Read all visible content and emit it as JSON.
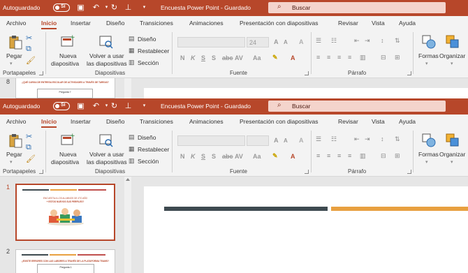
{
  "titlebar": {
    "autosave_label": "Autoguardado",
    "autosave_state": "Sí",
    "doc_title": "Encuesta Power Point  -  Guardado",
    "search_placeholder": "Buscar"
  },
  "tabs": [
    "Archivo",
    "Inicio",
    "Insertar",
    "Diseño",
    "Transiciones",
    "Animaciones",
    "Presentación con diapositivas",
    "Revisar",
    "Vista",
    "Ayuda"
  ],
  "active_tab": "Inicio",
  "ribbon": {
    "paste_label": "Pegar",
    "new_slide_line1": "Nueva",
    "new_slide_line2": "diapositiva",
    "reuse_line1": "Volver a usar",
    "reuse_line2": "las diapositivas",
    "layout_label": "Diseño",
    "reset_label": "Restablecer",
    "section_label": "Sección",
    "font_size": "24",
    "format_buttons": [
      "N",
      "K",
      "S",
      "S",
      "AV",
      "Aa"
    ],
    "shapes_label": "Formas",
    "arrange_label": "Organizar",
    "group_labels": {
      "clipboard": "Portapapeles",
      "slides": "Diapositivas",
      "font": "Fuente",
      "paragraph": "Párrafo"
    }
  },
  "back_window": {
    "thumb_number": "8",
    "thumb_heading": "¿QUÉ CARGA DE ENTREGA ESCOLAR DE ACTIVIDADES A TRAVÉS DE TAREAS?",
    "thumb_box": "Pregunta 7"
  },
  "front_window": {
    "slides": [
      {
        "number": "1",
        "text_line1": "ENCUESTA A LOS ALUMNOS DE 4TO AÑO",
        "text_line2": "+ ESTOS NUEVOS SUS PERFILES?"
      },
      {
        "number": "2",
        "text_line1": "¿EXISTE ERRORES CON LAS LABORES A TRAVÉS DE LA PLATAFORMA TEAMS?",
        "box": "Pregunta 1"
      }
    ]
  },
  "colors": {
    "accent": "#b7472a",
    "stripe_dark": "#3e4a50",
    "stripe_orange": "#e8a040",
    "stripe_red": "#c0504d"
  }
}
